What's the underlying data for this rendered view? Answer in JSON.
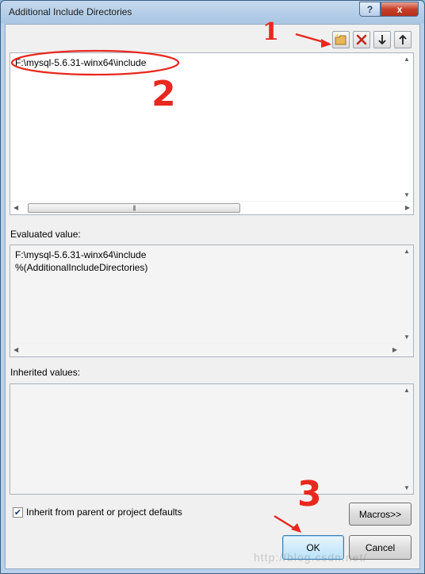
{
  "window": {
    "title": "Additional Include Directories",
    "help_label": "?",
    "close_label": "x"
  },
  "toolbar": {
    "new_line_icon": "new-folder-icon",
    "delete_icon": "delete-x-icon",
    "move_down_icon": "arrow-down-icon",
    "move_up_icon": "arrow-up-icon"
  },
  "directories": {
    "lines": [
      "F:\\mysql-5.6.31-winx64\\include"
    ]
  },
  "evaluated": {
    "label": "Evaluated value:",
    "lines": [
      "F:\\mysql-5.6.31-winx64\\include",
      "%(AdditionalIncludeDirectories)"
    ]
  },
  "inherited": {
    "label": "Inherited values:",
    "lines": []
  },
  "footer": {
    "inherit_label": "Inherit from parent or project defaults",
    "inherit_checked": true,
    "macros_label": "Macros>>",
    "ok_label": "OK",
    "cancel_label": "Cancel"
  },
  "annotations": {
    "one": "1",
    "two": "2",
    "three": "3"
  },
  "watermark": "http://blog.csdn.net/",
  "colors": {
    "annotation_red": "#e8281e",
    "accent": "#3b78c7"
  }
}
